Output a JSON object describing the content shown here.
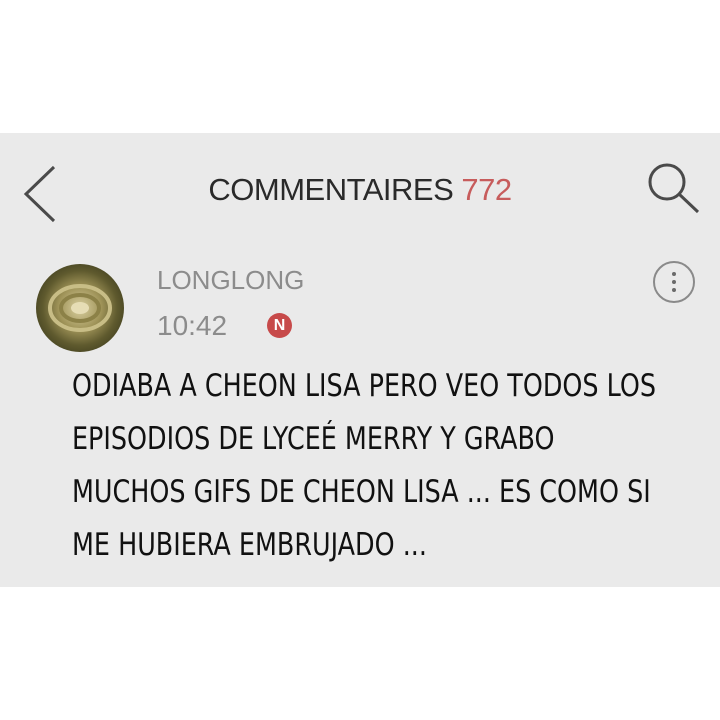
{
  "header": {
    "title": "COMMENTAIRES",
    "count": "772"
  },
  "icons": {
    "back": "chevron-left-icon",
    "search": "search-icon",
    "more": "more-vertical-icon"
  },
  "comment": {
    "username": "LONGLONG",
    "time": "10:42",
    "badge": "N",
    "text_lines": [
      "ODIABA A CHEON LISA PERO VEO TODOS LOS",
      "EPISODIOS DE LYCEÉ MERRY Y GRABO",
      "MUCHOS GIFS DE CHEON LISA ... ES COMO SI",
      "ME HUBIERA EMBRUJADO ..."
    ]
  },
  "colors": {
    "background": "#eaeaea",
    "count_accent": "#c75c5c",
    "badge": "#c74a4a",
    "meta_text": "#8c8c8c"
  }
}
